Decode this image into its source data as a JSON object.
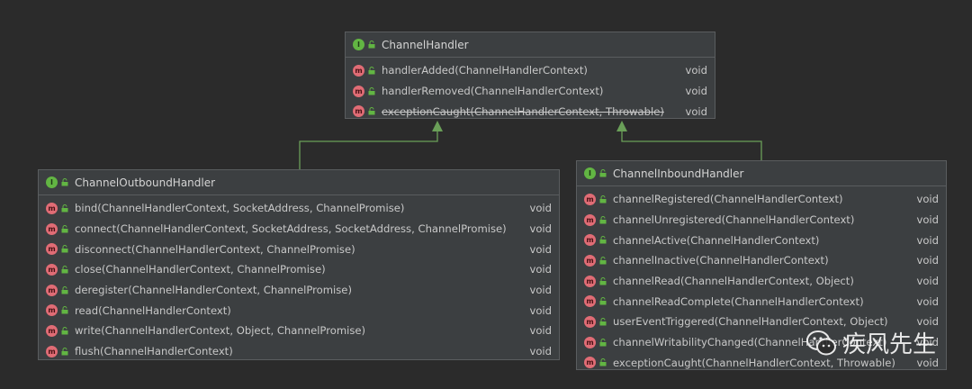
{
  "channel_handler": {
    "title": "ChannelHandler",
    "methods": [
      {
        "signature": "handlerAdded(ChannelHandlerContext)",
        "return": "void",
        "deprecated": false
      },
      {
        "signature": "handlerRemoved(ChannelHandlerContext)",
        "return": "void",
        "deprecated": false
      },
      {
        "signature": "exceptionCaught(ChannelHandlerContext, Throwable)",
        "return": "void",
        "deprecated": true
      }
    ]
  },
  "outbound_handler": {
    "title": "ChannelOutboundHandler",
    "methods": [
      {
        "signature": "bind(ChannelHandlerContext, SocketAddress, ChannelPromise)",
        "return": "void"
      },
      {
        "signature": "connect(ChannelHandlerContext, SocketAddress, SocketAddress, ChannelPromise)",
        "return": "void"
      },
      {
        "signature": "disconnect(ChannelHandlerContext, ChannelPromise)",
        "return": "void"
      },
      {
        "signature": "close(ChannelHandlerContext, ChannelPromise)",
        "return": "void"
      },
      {
        "signature": "deregister(ChannelHandlerContext, ChannelPromise)",
        "return": "void"
      },
      {
        "signature": "read(ChannelHandlerContext)",
        "return": "void"
      },
      {
        "signature": "write(ChannelHandlerContext, Object, ChannelPromise)",
        "return": "void"
      },
      {
        "signature": "flush(ChannelHandlerContext)",
        "return": "void"
      }
    ]
  },
  "inbound_handler": {
    "title": "ChannelInboundHandler",
    "methods": [
      {
        "signature": "channelRegistered(ChannelHandlerContext)",
        "return": "void"
      },
      {
        "signature": "channelUnregistered(ChannelHandlerContext)",
        "return": "void"
      },
      {
        "signature": "channelActive(ChannelHandlerContext)",
        "return": "void"
      },
      {
        "signature": "channelInactive(ChannelHandlerContext)",
        "return": "void"
      },
      {
        "signature": "channelRead(ChannelHandlerContext, Object)",
        "return": "void"
      },
      {
        "signature": "channelReadComplete(ChannelHandlerContext)",
        "return": "void"
      },
      {
        "signature": "userEventTriggered(ChannelHandlerContext, Object)",
        "return": "void"
      },
      {
        "signature": "channelWritabilityChanged(ChannelHandlerContext)",
        "return": "void"
      },
      {
        "signature": "exceptionCaught(ChannelHandlerContext, Throwable)",
        "return": "void"
      }
    ]
  },
  "icons": {
    "interface_badge": "I",
    "method_badge": "m"
  },
  "colors": {
    "background": "#2b2b2b",
    "box": "#3c3f41",
    "arrow": "#6a9f58",
    "interface_icon": "#62b543",
    "method_icon": "#e06c75"
  },
  "watermark": {
    "text": "疾风先生",
    "logo": "wechat-icon"
  }
}
